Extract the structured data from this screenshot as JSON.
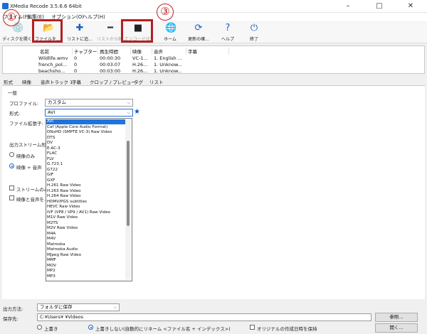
{
  "window": {
    "title": "XMedia Recode 3.5.6.6 64bit",
    "controls": [
      "–",
      "□",
      "✕"
    ]
  },
  "menu": [
    "ファイル(F)",
    "編集(E)",
    "オプション(O)",
    "ヘルプ(H)"
  ],
  "toolbar": [
    {
      "name": "open-disc",
      "label": "ディスクを開く",
      "icon": "disc-icon",
      "glyph": "💿",
      "enabled": true
    },
    {
      "name": "open-file",
      "label": "ファイルを...",
      "icon": "folder-icon",
      "glyph": "📂",
      "enabled": true
    },
    {
      "name": "add-to-list",
      "label": "リストに追...",
      "icon": "plus-icon",
      "glyph": "✚",
      "enabled": true
    },
    {
      "name": "remove-from-list",
      "label": "リストから削...",
      "icon": "minus-icon",
      "glyph": "━",
      "enabled": false
    },
    {
      "name": "encode",
      "label": "エンコード(E)",
      "icon": "encode-icon",
      "glyph": "■",
      "enabled": false
    },
    {
      "name": "home",
      "label": "ホーム",
      "icon": "globe-icon",
      "glyph": "🌐",
      "enabled": true
    },
    {
      "name": "update",
      "label": "更新の確...",
      "icon": "refresh-icon",
      "glyph": "⟳",
      "enabled": true
    },
    {
      "name": "help",
      "label": "ヘルプ",
      "icon": "help-icon",
      "glyph": "?",
      "enabled": true
    },
    {
      "name": "exit",
      "label": "終了",
      "icon": "power-icon",
      "glyph": "⏻",
      "enabled": true
    }
  ],
  "annotations": [
    "①",
    "②",
    "③"
  ],
  "file_list": {
    "columns": [
      "名前",
      "チャプター",
      "再生時間",
      "映像",
      "音声",
      "字幕"
    ],
    "rows": [
      [
        "Wildlife.wmv",
        "0",
        "00:00:30",
        "VC-1...",
        "1. English ...",
        ""
      ],
      [
        "french_pol...",
        "0",
        "00:03:07",
        "H.26...",
        "1. Unknow...",
        ""
      ],
      [
        "beachsho...",
        "0",
        "00:03:00",
        "H.26...",
        "1. Unknow...",
        ""
      ]
    ]
  },
  "tabs": [
    "形式",
    "映像",
    "音声トラック 1",
    "字幕",
    "クロップ / プレビュー",
    "タグ",
    "リスト"
  ],
  "format_panel": {
    "section_title": "一般",
    "profile_label": "プロファイル:",
    "profile_value": "カスタム",
    "format_label": "形式:",
    "format_value": "AVI",
    "extension_label": "ファイル拡張子:",
    "stream_label": "出力ストリーム形式",
    "radio_video_only": "映像のみ",
    "radio_video_audio": "映像 + 音声",
    "check_stream_only": "ストリームのみ",
    "check_video_audio": "映像と音声を..."
  },
  "format_options": [
    "AVI",
    "Caf (Apple Core Audio Format)",
    "DNxHD (SMPTE VC-3) Raw Video",
    "DTS",
    "DV",
    "E-AC-3",
    "FLAC",
    "FLV",
    "G.723.1",
    "G722",
    "GIF",
    "GXF",
    "H.261 Raw Video",
    "H.263 Raw Video",
    "H.264 Raw Video",
    "HDMV/PGS subtitles",
    "HEVC Raw Video",
    "IVF (VP8 / VP9 / AV1) Raw Video",
    "M1V Raw Video",
    "M2TS",
    "M2V Raw Video",
    "M4A",
    "M4V",
    "Matroska",
    "Matroska Audio",
    "MJpeg Raw Video",
    "MMF",
    "MOV",
    "MP2",
    "MP3"
  ],
  "bottom": {
    "output_label": "出力方法:",
    "output_value": "フォルダに保存",
    "dest_label": "保存先:",
    "dest_value": "C:¥Users¥      ¥Videos",
    "browse_label": "参照...",
    "open_label": "開く...",
    "overwrite_label": "上書き",
    "no_overwrite_label": "上書きしない(自動的にリネーム <ファイル名 + インデックス>)",
    "keep_date_label": "オリジナルの作成日時を保持"
  }
}
